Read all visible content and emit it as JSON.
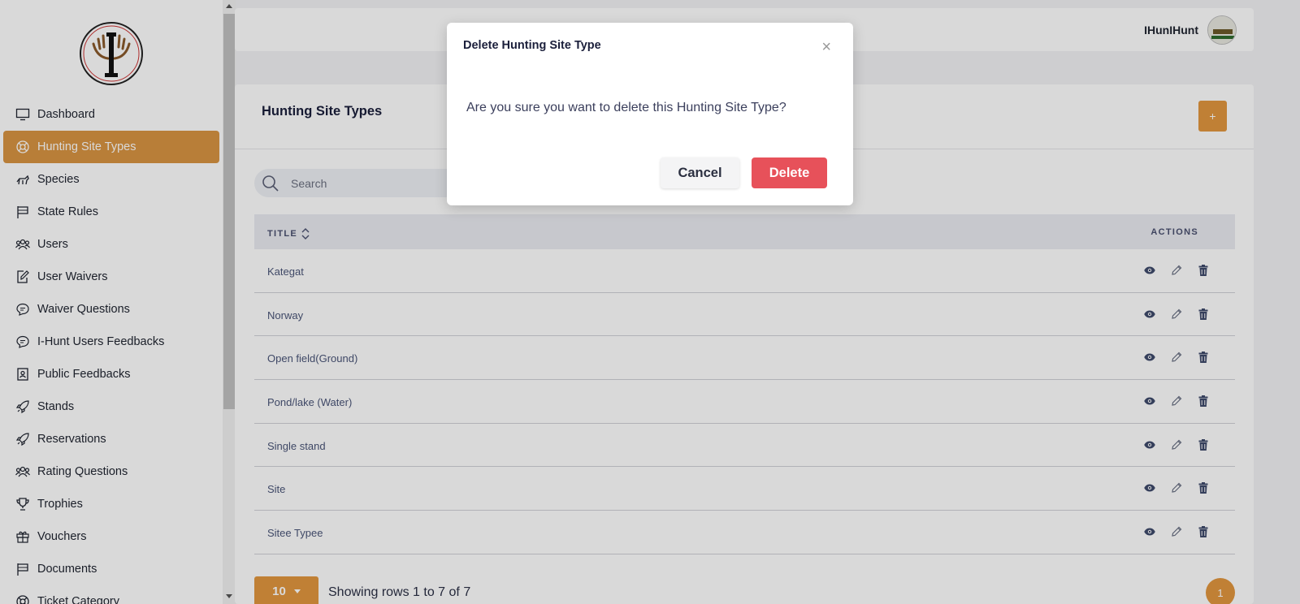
{
  "sidebar": {
    "items": [
      {
        "label": "Dashboard",
        "icon": "monitor-icon",
        "active": false
      },
      {
        "label": "Hunting Site Types",
        "icon": "lifebuoy-icon",
        "active": true
      },
      {
        "label": "Species",
        "icon": "animal-icon",
        "active": false
      },
      {
        "label": "State Rules",
        "icon": "flag-icon",
        "active": false
      },
      {
        "label": "Users",
        "icon": "users-icon",
        "active": false
      },
      {
        "label": "User Waivers",
        "icon": "document-edit-icon",
        "active": false
      },
      {
        "label": "Waiver Questions",
        "icon": "chat-icon",
        "active": false
      },
      {
        "label": "I-Hunt Users Feedbacks",
        "icon": "chat-icon",
        "active": false
      },
      {
        "label": "Public Feedbacks",
        "icon": "contact-card-icon",
        "active": false
      },
      {
        "label": "Stands",
        "icon": "rocket-icon",
        "active": false
      },
      {
        "label": "Reservations",
        "icon": "rocket-icon",
        "active": false
      },
      {
        "label": "Rating Questions",
        "icon": "users-icon",
        "active": false
      },
      {
        "label": "Trophies",
        "icon": "trophy-icon",
        "active": false
      },
      {
        "label": "Vouchers",
        "icon": "gift-icon",
        "active": false
      },
      {
        "label": "Documents",
        "icon": "flag-icon",
        "active": false
      },
      {
        "label": "Ticket Category",
        "icon": "lifebuoy-icon",
        "active": false
      }
    ]
  },
  "topbar": {
    "username": "IHunIHunt"
  },
  "page": {
    "title": "Hunting Site Types",
    "add_label": "+",
    "search_placeholder": "Search"
  },
  "table": {
    "col_title": "TITLE",
    "col_actions": "ACTIONS",
    "rows": [
      "Kategat",
      "Norway",
      "Open field(Ground)",
      "Pond/lake (Water)",
      "Single stand",
      "Site",
      "Sitee Typee"
    ]
  },
  "footer": {
    "page_size": "10",
    "showing": "Showing rows 1 to 7 of 7",
    "current_page": "1"
  },
  "modal": {
    "title": "Delete Hunting Site Type",
    "close": "×",
    "message": "Are you sure you want to delete this Hunting Site Type?",
    "cancel_label": "Cancel",
    "delete_label": "Delete"
  },
  "colors": {
    "accent": "#e2973f",
    "danger": "#e7515a",
    "overlay": "rgba(0,0,0,0.15)"
  }
}
